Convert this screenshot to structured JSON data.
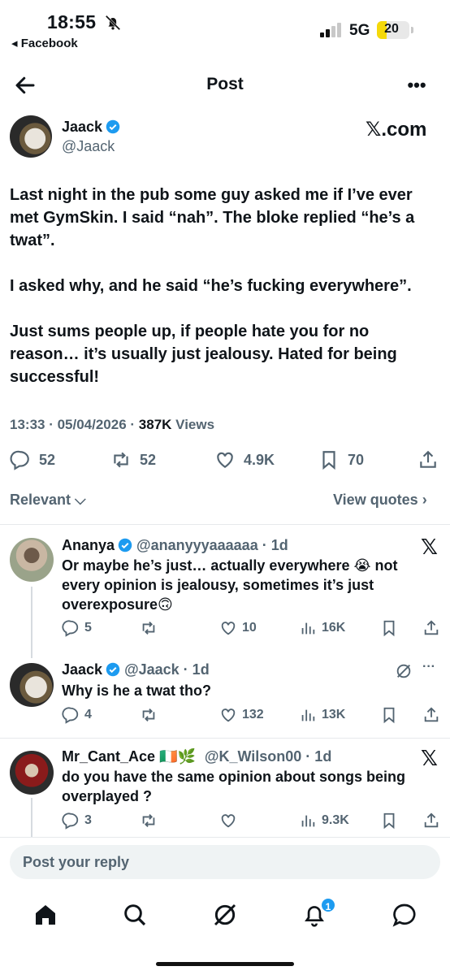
{
  "status_bar": {
    "time": "18:55",
    "back_app": "◂ Facebook",
    "network": "5G",
    "battery": "20"
  },
  "header": {
    "title": "Post"
  },
  "post": {
    "author_name": "Jaack",
    "author_handle": "@Jaack",
    "source": "𝕏.com",
    "paragraphs": [
      "Last night in the pub some guy asked me if I’ve ever met GymSkin. I said “nah”. The bloke replied “he’s a twat”.",
      "I asked why, and he said “he’s fucking everywhere”.",
      "Just sums people up, if people hate you for no reason… it’s usually just jealousy. Hated for being successful!"
    ],
    "time": "13:33 · 05/04/2026 ·",
    "views_count": "387K",
    "views_label": "Views",
    "replies": "52",
    "reposts": "52",
    "likes": "4.9K",
    "bookmarks": "70"
  },
  "sort": {
    "label": "Relevant ⌵",
    "view_quotes": "View quotes ›"
  },
  "replies": [
    {
      "name": "Ananya",
      "handle": "@ananyyyaaaaaa · 1d",
      "text": "Or maybe he’s just… actually everywhere 😭 not every opinion is jealousy, sometimes it’s just overexposure🙃",
      "replies": "5",
      "reposts": "",
      "likes": "10",
      "views": "16K"
    },
    {
      "name": "Jaack",
      "handle": "@Jaack · 1d",
      "text": "Why is he a twat tho?",
      "replies": "4",
      "reposts": "",
      "likes": "132",
      "views": "13K"
    },
    {
      "name": "Mr_Cant_Ace 🇮🇪🌿",
      "handle": "@K_Wilson00 · 1d",
      "text": "do you have the same opinion about songs being overplayed ?",
      "replies": "3",
      "reposts": "",
      "likes": "",
      "views": "9.3K"
    }
  ],
  "reply_box": {
    "placeholder": "Post your reply"
  },
  "nav": {
    "notification_badge": "1"
  },
  "colors": {
    "accent": "#1d9bf0",
    "muted": "#536471",
    "text": "#0f1419"
  }
}
